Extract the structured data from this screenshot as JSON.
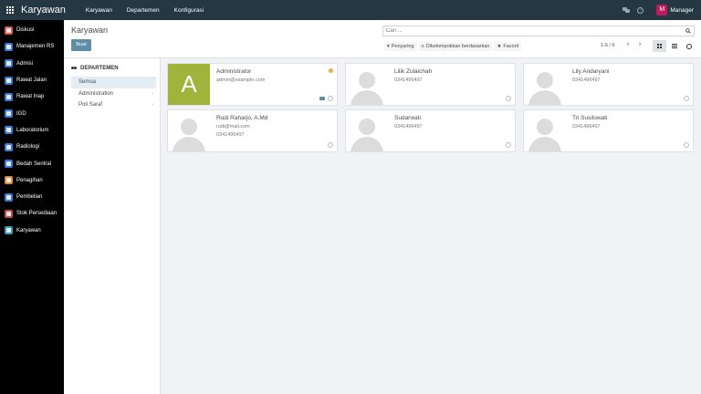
{
  "navbar": {
    "brand": "Karyawan",
    "menu": [
      "Karyawan",
      "Departemen",
      "Konfigurasi"
    ],
    "user": {
      "initial": "M",
      "name": "Manager"
    },
    "icons": [
      "apps-icon",
      "chat-icon",
      "help-icon"
    ]
  },
  "sidebar": {
    "items": [
      {
        "label": "Diskusi",
        "color": "#e05a5a"
      },
      {
        "label": "Manajemen RS",
        "color": "#3a7bd5"
      },
      {
        "label": "Admisi",
        "color": "#3a7bd5"
      },
      {
        "label": "Rawat Jalan",
        "color": "#3a7bd5"
      },
      {
        "label": "Rawat Inap",
        "color": "#3a7bd5"
      },
      {
        "label": "IGD",
        "color": "#3a7bd5"
      },
      {
        "label": "Laboratorium",
        "color": "#3a7bd5"
      },
      {
        "label": "Radiologi",
        "color": "#3a7bd5"
      },
      {
        "label": "Bedah Sentral",
        "color": "#3a7bd5"
      },
      {
        "label": "Penagihan",
        "color": "#e08a3c"
      },
      {
        "label": "Pembelian",
        "color": "#3a7bd5"
      },
      {
        "label": "Stok Persediaan",
        "color": "#c0504d"
      },
      {
        "label": "Karyawan",
        "color": "#3a9bb5"
      }
    ]
  },
  "control": {
    "title": "Karyawan",
    "create_label": "Buat",
    "search_placeholder": "Cari ...",
    "filter_label": "Penyaring",
    "group_label": "Dikelompokkan berdasarkan",
    "favorite_label": "Favorit",
    "pager": "1-6 / 6"
  },
  "departments": {
    "header": "DEPARTEMEN",
    "items": [
      {
        "label": "Semua",
        "active": true
      },
      {
        "label": "Administration"
      },
      {
        "label": "Poli Saraf"
      }
    ]
  },
  "employees": [
    {
      "name": "Administrator",
      "email": "admin@example.com",
      "phone": "",
      "initial": "A"
    },
    {
      "name": "Lilik Zulaichah",
      "email": "",
      "phone": "0341496497"
    },
    {
      "name": "Lily Andaryani",
      "email": "",
      "phone": "0341496497"
    },
    {
      "name": "Rudi Raharjo, A.Md",
      "email": "rudi@mail.com",
      "phone": "0341496497"
    },
    {
      "name": "Sudarwati",
      "email": "",
      "phone": "0341496497"
    },
    {
      "name": "Tri Susilowati",
      "email": "",
      "phone": "0341496497"
    }
  ]
}
